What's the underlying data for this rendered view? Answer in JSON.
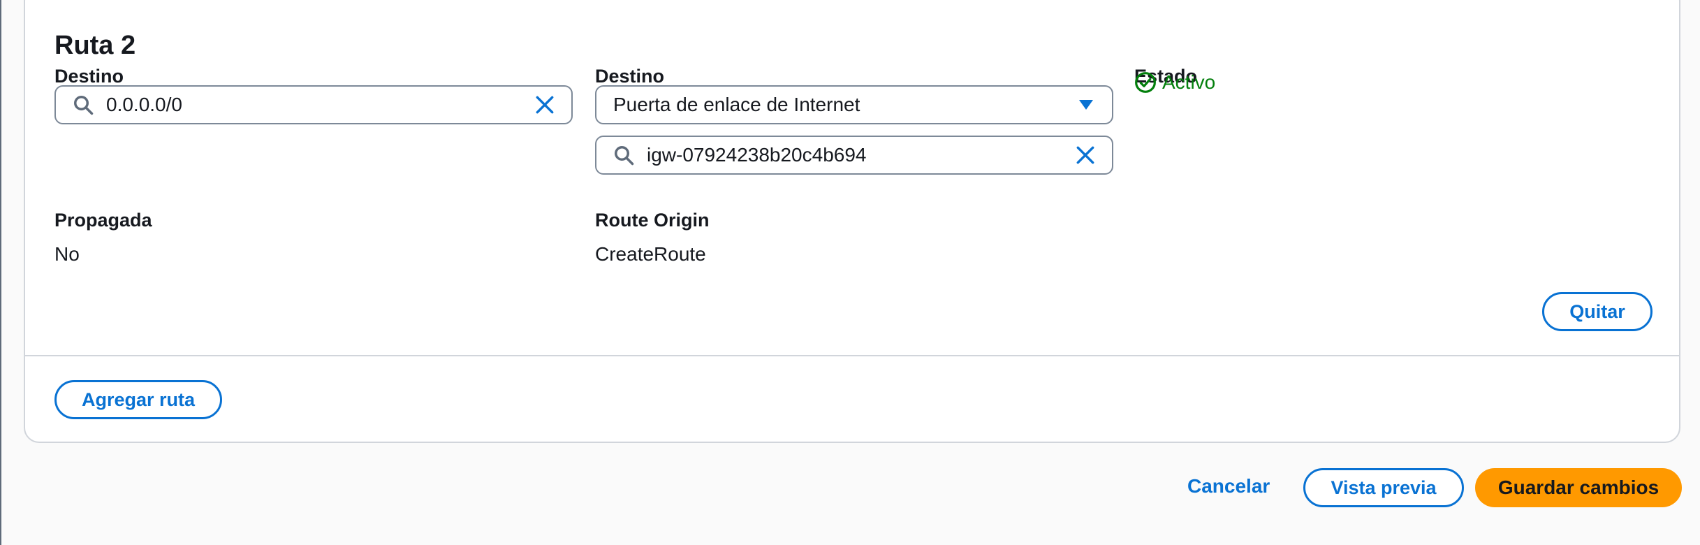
{
  "route": {
    "title": "Ruta 2",
    "destination": {
      "label": "Destino",
      "value": "0.0.0.0/0"
    },
    "target": {
      "label": "Destino",
      "type_selected": "Puerta de enlace de Internet",
      "id_value": "igw-07924238b20c4b694"
    },
    "status": {
      "label": "Estado",
      "value": "Activo",
      "color": "#037f0c"
    },
    "propagated": {
      "label": "Propagada",
      "value": "No"
    },
    "origin": {
      "label": "Route Origin",
      "value": "CreateRoute"
    },
    "remove_label": "Quitar"
  },
  "add_route_label": "Agregar ruta",
  "footer": {
    "cancel_label": "Cancelar",
    "preview_label": "Vista previa",
    "save_label": "Guardar cambios"
  },
  "colors": {
    "accent": "#0972d3",
    "primary": "#ff9900",
    "success": "#037f0c"
  }
}
